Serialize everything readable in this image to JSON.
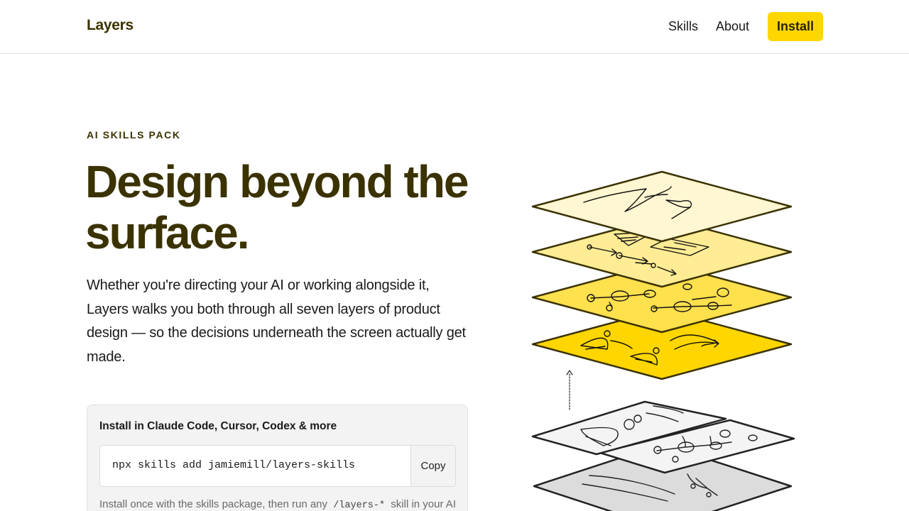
{
  "header": {
    "brand": "Layers",
    "nav": {
      "skills": "Skills",
      "about": "About"
    },
    "install_label": "Install"
  },
  "hero": {
    "eyebrow": "AI SKILLS PACK",
    "headline_line1": "Design beyond the",
    "headline_line2": "surface.",
    "lede": "Whether you're directing your AI or working alongside it, Layers walks you both through all seven layers of product design — so the decisions underneath the screen actually get made."
  },
  "install_card": {
    "title": "Install in Claude Code, Cursor, Codex & more",
    "command": "npx skills add jamiemill/layers-skills",
    "copy_label": "Copy",
    "note_prefix": "Install once with the skills package, then run any",
    "note_code": "/layers-*",
    "note_suffix": "skill in your AI"
  },
  "colors": {
    "accent": "#ffd600",
    "brand_text": "#3a3200",
    "layer_1": "#fff6d2",
    "layer_2": "#ffec94",
    "layer_3": "#ffe04d",
    "layer_4": "#ffd600",
    "gray_light": "#f4f4f4",
    "gray_mid": "#dcdcdc"
  },
  "illustration": {
    "name": "stacked-design-layers-icon"
  }
}
